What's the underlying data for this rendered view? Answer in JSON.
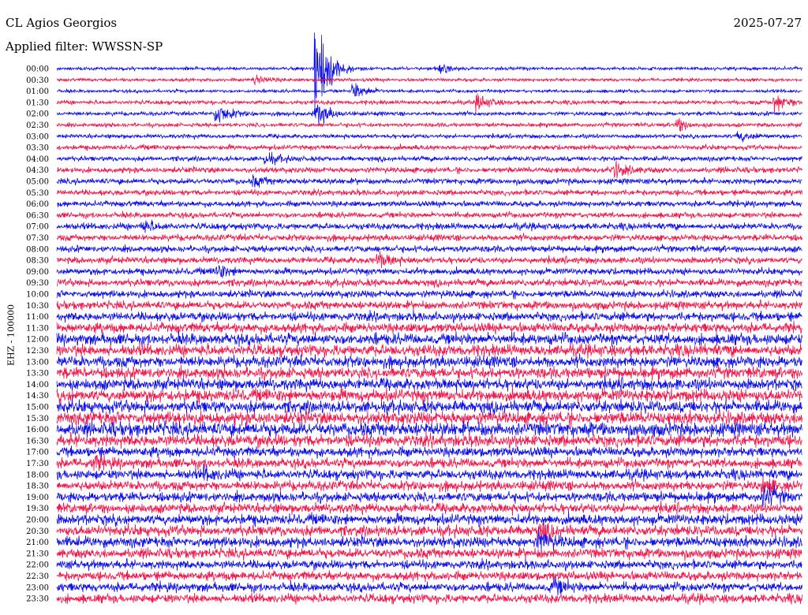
{
  "header": {
    "station": "CL Agios Georgios",
    "date": "2025-07-27",
    "filter": "Applied filter: WWSSN-SP",
    "channel": "EHZ - 100000"
  },
  "colors": {
    "trace_a": "#1010e8",
    "trace_b": "#f0184c"
  },
  "chart_data": {
    "type": "line",
    "title": "CL Agios Georgios",
    "ylabel": "EHZ - 100000",
    "rows": [
      "00:00",
      "00:30",
      "01:00",
      "01:30",
      "02:00",
      "02:30",
      "03:00",
      "03:30",
      "04:00",
      "04:30",
      "05:00",
      "05:30",
      "06:00",
      "06:30",
      "07:00",
      "07:30",
      "08:00",
      "08:30",
      "09:00",
      "09:30",
      "10:00",
      "10:30",
      "11:00",
      "11:30",
      "12:00",
      "12:30",
      "13:00",
      "13:30",
      "14:00",
      "14:30",
      "15:00",
      "15:30",
      "16:00",
      "16:30",
      "17:00",
      "17:30",
      "18:00",
      "18:30",
      "19:00",
      "19:30",
      "20:00",
      "20:30",
      "21:00",
      "21:30",
      "22:00",
      "22:30",
      "23:00",
      "23:30"
    ],
    "noise_level": [
      0.2,
      0.2,
      0.2,
      0.25,
      0.25,
      0.25,
      0.25,
      0.3,
      0.3,
      0.35,
      0.35,
      0.35,
      0.35,
      0.35,
      0.4,
      0.4,
      0.4,
      0.4,
      0.4,
      0.45,
      0.45,
      0.5,
      0.55,
      0.6,
      0.7,
      0.7,
      0.7,
      0.7,
      0.7,
      0.75,
      0.75,
      0.8,
      0.85,
      0.75,
      0.6,
      0.6,
      0.6,
      0.6,
      0.6,
      0.6,
      0.65,
      0.65,
      0.65,
      0.6,
      0.55,
      0.55,
      0.55,
      0.55
    ],
    "events": [
      {
        "row": 0,
        "time_min": 10.5,
        "amp": 6.5
      },
      {
        "row": 0,
        "time_min": 15.5,
        "amp": 0.5
      },
      {
        "row": 1,
        "time_min": 8.0,
        "amp": 0.6
      },
      {
        "row": 2,
        "time_min": 12.0,
        "amp": 1.0
      },
      {
        "row": 3,
        "time_min": 17.0,
        "amp": 0.8
      },
      {
        "row": 3,
        "time_min": 29.0,
        "amp": 1.1
      },
      {
        "row": 4,
        "time_min": 6.5,
        "amp": 1.2
      },
      {
        "row": 4,
        "time_min": 10.5,
        "amp": 1.4
      },
      {
        "row": 5,
        "time_min": 25.0,
        "amp": 0.8
      },
      {
        "row": 6,
        "time_min": 27.5,
        "amp": 0.6
      },
      {
        "row": 8,
        "time_min": 8.5,
        "amp": 0.6
      },
      {
        "row": 9,
        "time_min": 22.5,
        "amp": 0.8
      },
      {
        "row": 10,
        "time_min": 8.0,
        "amp": 0.5
      },
      {
        "row": 14,
        "time_min": 3.5,
        "amp": 0.6
      },
      {
        "row": 17,
        "time_min": 13.0,
        "amp": 0.8
      },
      {
        "row": 18,
        "time_min": 6.5,
        "amp": 0.7
      },
      {
        "row": 35,
        "time_min": 1.5,
        "amp": 0.6
      },
      {
        "row": 36,
        "time_min": 6.0,
        "amp": 0.6
      },
      {
        "row": 37,
        "time_min": 28.5,
        "amp": 0.9
      },
      {
        "row": 38,
        "time_min": 28.5,
        "amp": 1.2
      },
      {
        "row": 41,
        "time_min": 19.5,
        "amp": 0.8
      },
      {
        "row": 42,
        "time_min": 19.5,
        "amp": 1.0
      },
      {
        "row": 46,
        "time_min": 20.0,
        "amp": 0.9
      }
    ]
  }
}
